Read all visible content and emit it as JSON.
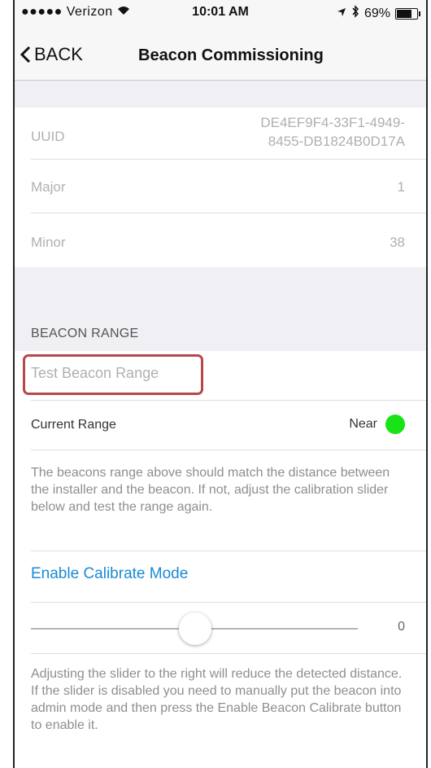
{
  "status_bar": {
    "carrier": "●●●●● Verizon",
    "time": "10:01 AM",
    "battery": "69%",
    "battery_level": 0.69
  },
  "nav": {
    "back_label": "BACK",
    "title": "Beacon Commissioning"
  },
  "beacon_info": {
    "uuid_label": "UUID",
    "uuid_line1": "DE4EF9F4-33F1-4949-",
    "uuid_line2": "8455-DB1824B0D17A",
    "major_label": "Major",
    "major_value": "1",
    "minor_label": "Minor",
    "minor_value": "38"
  },
  "range_section": {
    "header": "BEACON RANGE",
    "test_button": "Test Beacon Range",
    "current_range_label": "Current Range",
    "current_range_value": "Near",
    "status_color": "#17e317",
    "note": "The beacons range above should match the distance between the installer and the beacon. If not, adjust the calibration slider below and test the range again."
  },
  "calibration": {
    "enable_label": "Enable Calibrate Mode",
    "slider_value": "0",
    "note": "Adjusting the slider to the right will  reduce the detected distance. If the slider is disabled you need to manually put the beacon into admin mode and then press the Enable Beacon Calibrate button to enable it."
  },
  "colors": {
    "accent": "#1a8ad6",
    "highlight": "#b54848"
  }
}
